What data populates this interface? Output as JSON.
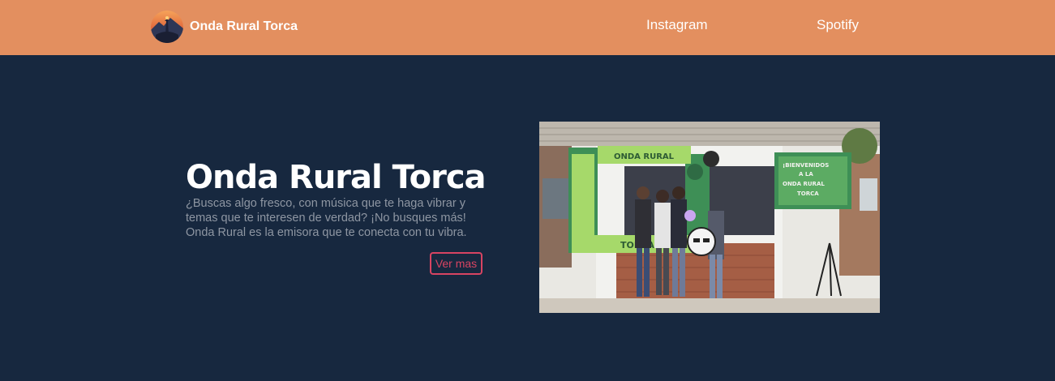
{
  "navbar": {
    "brand_name": "Onda Rural Torca",
    "logo_icon": "radio-station-logo-icon",
    "links": [
      {
        "label": "Instagram"
      },
      {
        "label": "Spotify"
      }
    ],
    "background_color": "#e38f5f"
  },
  "hero": {
    "title": "Onda Rural Torca",
    "description": "¿Buscas algo fresco, con música que te haga vibrar y temas que te interesen de verdad? ¡No busques más! Onda Rural es la emisora que te conecta con tu vibra.",
    "cta_label": "Ver mas",
    "cta_color": "#d84462",
    "background_color": "#17283f"
  },
  "photo": {
    "booth_sign": "ONDA RURAL",
    "welcome_sign": [
      "¡BIENVENIDOS",
      "A LA",
      "ONDA RURAL",
      "TORCA"
    ],
    "frame_label": "TORCA"
  }
}
